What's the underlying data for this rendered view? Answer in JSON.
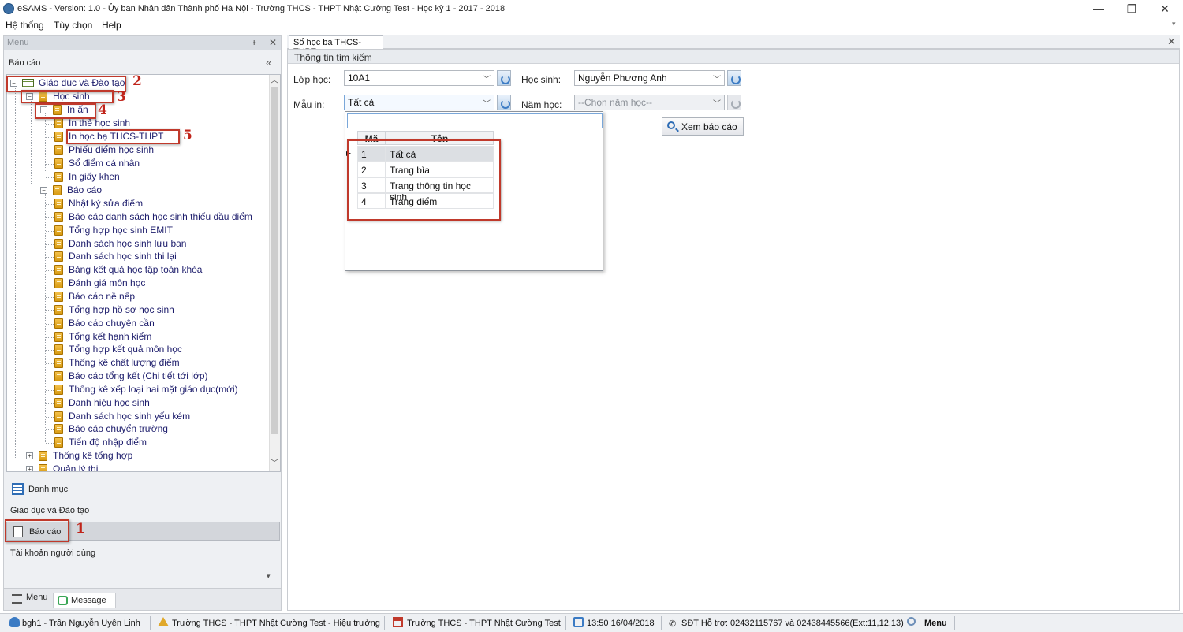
{
  "window": {
    "title": "eSAMS - Version: 1.0 - Ủy ban Nhân dân Thành phố Hà Nội - Trường THCS - THPT Nhật Cường Test - Học kỳ 1 - 2017 - 2018",
    "controls": {
      "minimize": "—",
      "restore": "❐",
      "close": "✕"
    }
  },
  "menubar": {
    "items": [
      "Hệ thống",
      "Tùy chọn",
      "Help"
    ]
  },
  "left_panel": {
    "header": "Menu",
    "pin": "ᵻ",
    "close": "✕",
    "section": "Báo cáo",
    "collapse": "«",
    "tree": {
      "root": "Giáo dục và Đào tạo",
      "hoc_sinh": "Học sinh",
      "in_an": "In ấn",
      "in_an_items": [
        "In thẻ học sinh",
        "In học bạ THCS-THPT",
        "Phiếu điểm học sinh",
        "Sổ điểm cá nhân",
        "In giấy khen"
      ],
      "bao_cao": "Báo cáo",
      "bao_cao_items": [
        "Nhật ký sửa điểm",
        "Báo cáo danh sách học sinh thiếu đầu điểm",
        "Tổng hợp học sinh EMIT",
        "Danh sách học sinh lưu ban",
        "Danh sách học sinh thi lại",
        "Bảng kết quả học tập toàn khóa",
        "Đánh giá môn học",
        "Báo cáo nề nếp",
        "Tổng hợp hồ sơ học sinh",
        "Báo cáo chuyên cần",
        "Tổng kết hạnh kiểm",
        "Tổng hợp kết quả môn học",
        "Thống kê chất lượng điểm",
        "Báo cáo tổng kết (Chi tiết tới lớp)",
        "Thống kê xếp loại hai mặt giáo dục(mới)",
        "Danh hiệu học sinh",
        "Danh sách học sinh yếu kém",
        "Báo cáo chuyển trường",
        "Tiến độ nhập điểm"
      ],
      "thong_ke": "Thống kê tổng hợp",
      "quan_ly_thi": "Quản lý thi"
    },
    "nav": {
      "danh_muc": "Danh mục",
      "gddt": "Giáo dục và Đào tạo",
      "bao_cao": "Báo cáo",
      "tai_khoan": "Tài khoản người dùng"
    },
    "bottom_tabs": [
      "Menu",
      "Message"
    ]
  },
  "annotations": [
    "1",
    "2",
    "3",
    "4",
    "5"
  ],
  "document": {
    "tab": "Sổ học bạ THCS-THPT",
    "close": "✕",
    "group_title": "Thông tin tìm kiếm",
    "fields": {
      "lop_hoc_label": "Lớp học:",
      "lop_hoc_value": "10A1",
      "hoc_sinh_label": "Học sinh:",
      "hoc_sinh_value": "Nguyễn Phương Anh",
      "mau_in_label": "Mẫu in:",
      "mau_in_value": "Tất cả",
      "nam_hoc_label": "Năm học:",
      "nam_hoc_value": "--Chọn năm học--"
    },
    "report_button": "Xem báo cáo",
    "dropdown": {
      "columns": [
        "Mã",
        "Tên"
      ],
      "rows": [
        {
          "ma": "1",
          "ten": "Tất cả"
        },
        {
          "ma": "2",
          "ten": "Trang bìa"
        },
        {
          "ma": "3",
          "ten": "Trang thông tin học sinh"
        },
        {
          "ma": "4",
          "ten": "Trang điểm"
        }
      ]
    }
  },
  "statusbar": {
    "user": "bgh1 - Trần Nguyễn Uyên Linh",
    "role": "Trường THCS - THPT Nhật Cường Test - Hiệu trưởng",
    "school": "Trường THCS - THPT Nhật Cường Test",
    "datetime": "13:50 16/04/2018",
    "support": "SĐT Hỗ trợ: 02432115767 và 02438445566(Ext:11,12,13)",
    "menu": "Menu"
  },
  "colors": {
    "annotation_red": "#c0392b",
    "folder_gold": "#e0a82a",
    "accent_blue": "#3b7bc4"
  }
}
